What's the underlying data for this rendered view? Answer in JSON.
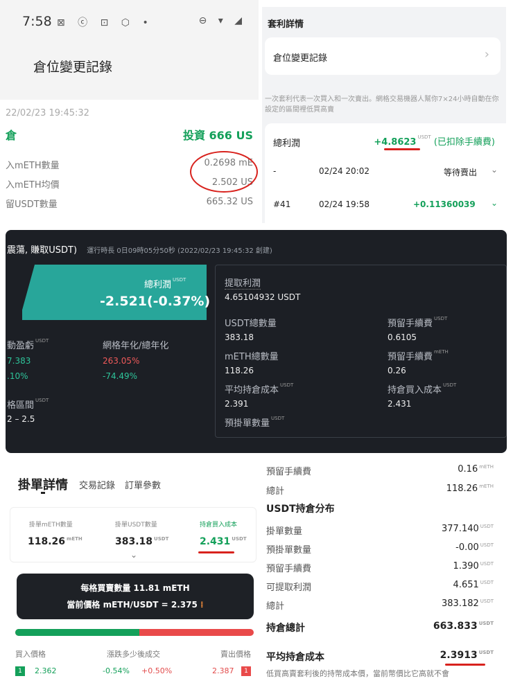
{
  "p1": {
    "status_time": "7:58",
    "status_dot": "•",
    "title": "倉位變更記錄",
    "timestamp": "22/02/23 19:45:32",
    "pos_label": "倉",
    "invest": "投資 666 US",
    "rows": [
      {
        "l": "入mETH數量",
        "v": "0.2698 mE"
      },
      {
        "l": "入mETH均價",
        "v": "2.502 US"
      },
      {
        "l": "留USDT數量",
        "v": "665.32 US"
      }
    ]
  },
  "p2": {
    "header": "套利詳情",
    "link": "倉位變更記錄",
    "chevron": "›",
    "note": "一次套利代表一次買入和一次賣出。網格交易機器人幫你7×24小時自動在你設定的區間裡低買高賣",
    "profit_label": "總利潤",
    "profit_val": "+4.8623",
    "profit_unit": "USDT",
    "profit_note": "(已扣除手續費)",
    "orders": [
      {
        "id": "-",
        "time": "02/24 20:02",
        "status": "等待賣出"
      },
      {
        "id": "#41",
        "time": "02/24 19:58",
        "status": "+0.11360039"
      }
    ]
  },
  "p3": {
    "header": "震蕩, 賺取USDT)",
    "runtime": "運行時長 0日09時05分50秒 (2022/02/23 19:45:32 創建)",
    "total_label": "總利潤",
    "total_val": "-2.521(-0.37%)",
    "float_label": "動盈虧",
    "float_v1": "7.383",
    "float_v2": ".10%",
    "grid_label": "網格年化/總年化",
    "grid_v1": "263.05%",
    "grid_v2": "-74.49%",
    "range_label": "格區間",
    "range_val": "2 – 2.5",
    "withdraw_label": "提取利潤",
    "withdraw_val": "4.65104932 USDT",
    "usdt_total_l": "USDT總數量",
    "usdt_total_v": "383.18",
    "fee1_l": "預留手續費",
    "fee1_v": "0.6105",
    "meth_total_l": "mETH總數量",
    "meth_total_v": "118.26",
    "fee2_l": "預留手續費",
    "fee2_v": "0.26",
    "avg_cost_l": "平均持倉成本",
    "avg_cost_v": "2.391",
    "buy_cost_l": "持倉買入成本",
    "buy_cost_v": "2.431",
    "pending_l": "預掛單數量",
    "u_usdt": "USDT",
    "u_meth": "mETH"
  },
  "p4": {
    "title": "掛單詳情",
    "tab1": "交易記錄",
    "tab2": "訂單參數",
    "c1_l": "掛單mETH數量",
    "c1_v": "118.26",
    "c1_u": "mETH",
    "c2_l": "掛單USDT數量",
    "c2_v": "383.18",
    "c2_u": "USDT",
    "c3_l": "持倉買入成本",
    "c3_v": "2.431",
    "c3_u": "USDT",
    "tip1": "每格買賣數量 11.81 mETH",
    "tip2": "當前價格  mETH/USDT = 2.375",
    "buy_price_l": "買入價格",
    "range_l": "漲跌多少後成交",
    "sell_price_l": "賣出價格",
    "buy_badge": "1",
    "buy_price": "2.362",
    "pct1": "-0.54%",
    "pct2": "+0.50%",
    "sell_price": "2.387",
    "sell_badge": "1",
    "green_ratio": 0.52
  },
  "p5": {
    "r1_l": "預留手續費",
    "r1_v": "0.16",
    "r1_u": "mETH",
    "r2_l": "總計",
    "r2_v": "118.26",
    "r2_u": "mETH",
    "section": "USDT持倉分布",
    "rows": [
      {
        "l": "掛單數量",
        "v": "377.140",
        "u": "USDT"
      },
      {
        "l": "預掛單數量",
        "v": "-0.00",
        "u": "USDT"
      },
      {
        "l": "預留手續費",
        "v": "1.390",
        "u": "USDT"
      },
      {
        "l": "可提取利潤",
        "v": "4.651",
        "u": "USDT"
      },
      {
        "l": "總計",
        "v": "383.182",
        "u": "USDT"
      }
    ],
    "hold_l": "持倉總計",
    "hold_v": "663.833",
    "hold_u": "USDT",
    "avg_l": "平均持倉成本",
    "avg_v": "2.3913",
    "avg_u": "USDT",
    "footer": "低買高賣套利後的持幣成本價，當前幣價比它高就不會"
  }
}
